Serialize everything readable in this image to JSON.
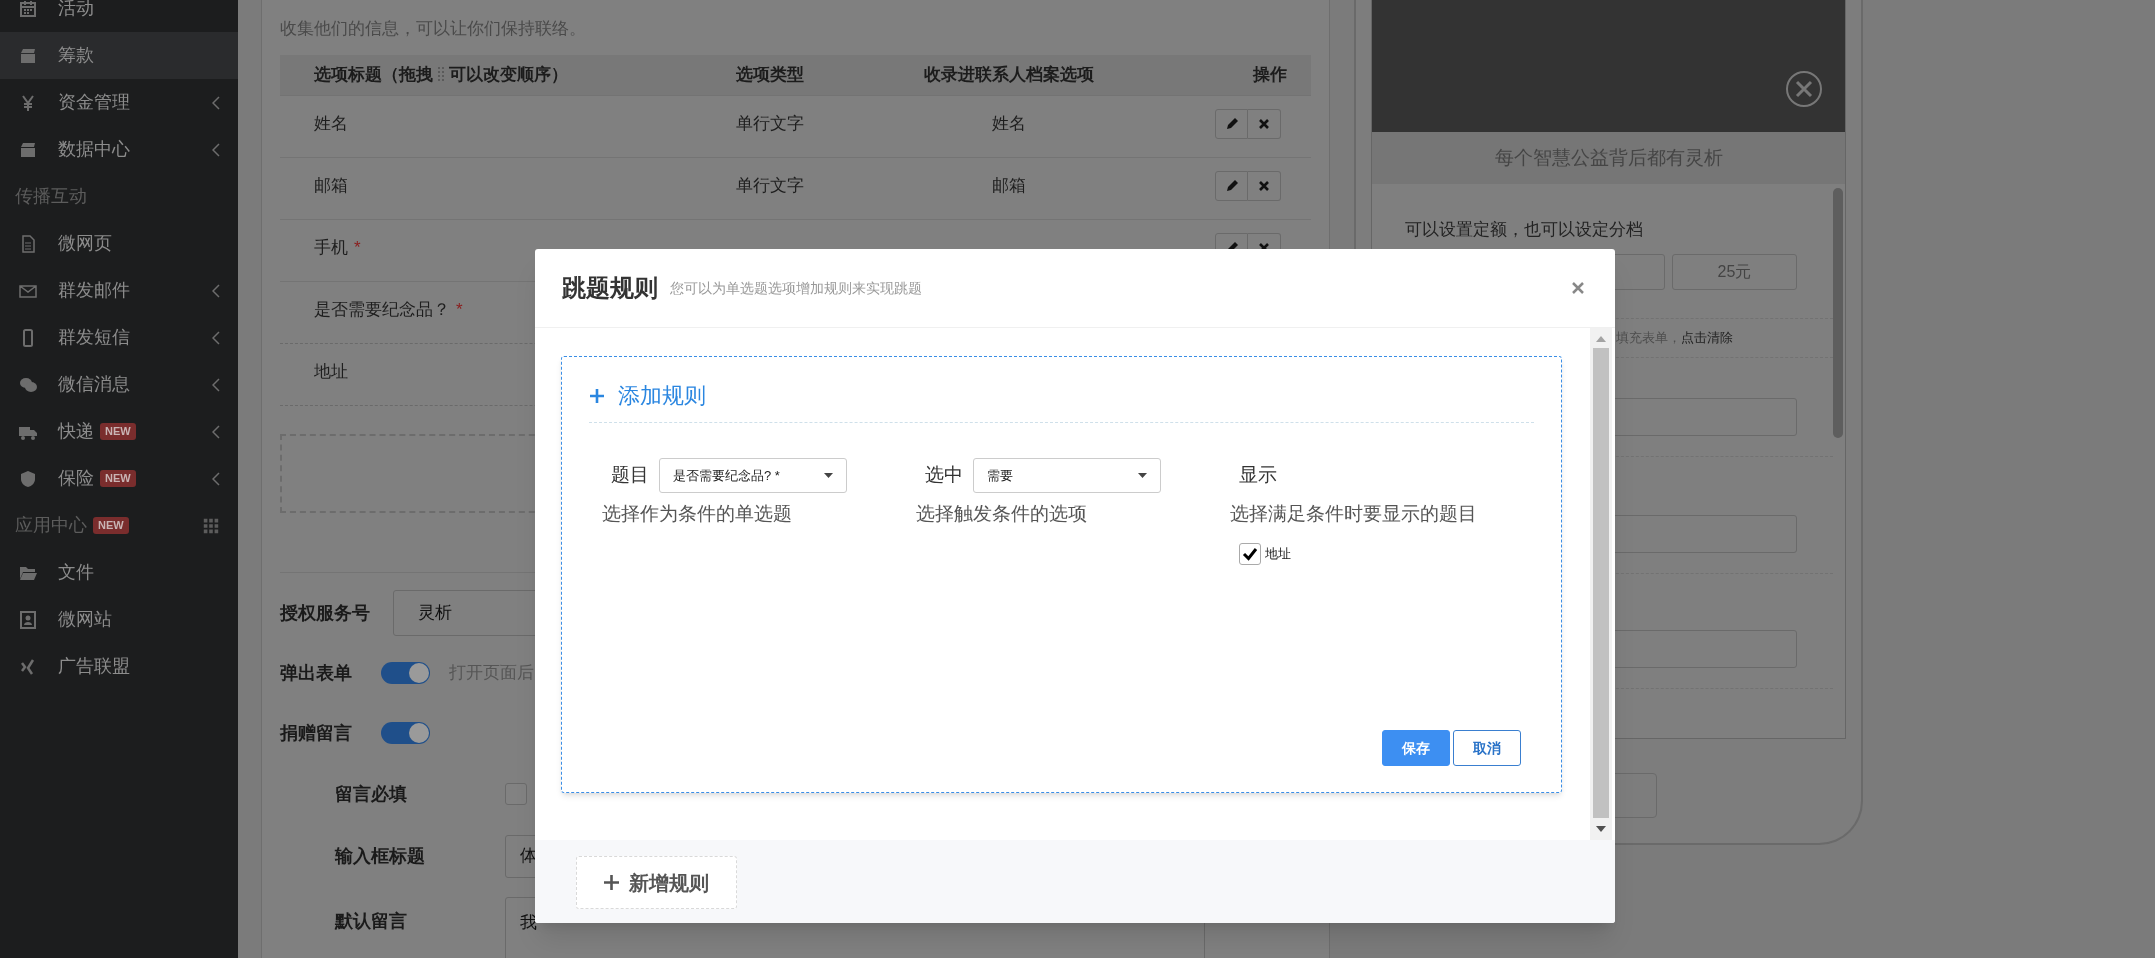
{
  "sidebar": {
    "items": [
      {
        "kind": "item",
        "label": "活动",
        "selected": false,
        "submenu": false
      },
      {
        "kind": "item",
        "label": "筹款",
        "selected": true,
        "submenu": false
      },
      {
        "kind": "item",
        "label": "资金管理",
        "selected": false,
        "submenu": true
      },
      {
        "kind": "item",
        "label": "数据中心",
        "selected": false,
        "submenu": true
      },
      {
        "kind": "group",
        "label": "传播互动"
      },
      {
        "kind": "item",
        "label": "微网页",
        "selected": false,
        "submenu": false
      },
      {
        "kind": "item",
        "label": "群发邮件",
        "selected": false,
        "submenu": true
      },
      {
        "kind": "item",
        "label": "群发短信",
        "selected": false,
        "submenu": true
      },
      {
        "kind": "item",
        "label": "微信消息",
        "selected": false,
        "submenu": true
      },
      {
        "kind": "item",
        "label": "快递",
        "badge": "NEW",
        "selected": false,
        "submenu": true
      },
      {
        "kind": "item",
        "label": "保险",
        "badge": "NEW",
        "selected": false,
        "submenu": true
      },
      {
        "kind": "group",
        "label": "应用中心",
        "badge": "NEW"
      },
      {
        "kind": "item",
        "label": "文件",
        "selected": false,
        "submenu": false
      },
      {
        "kind": "item",
        "label": "微网站",
        "selected": false,
        "submenu": false
      },
      {
        "kind": "item",
        "label": "广告联盟",
        "selected": false,
        "submenu": false
      }
    ]
  },
  "form_fields": {
    "intro": "收集他们的信息，可以让你们保持联络。",
    "columns": [
      {
        "label": "选项标题（拖拽",
        "label_after": "可以改变顺序）"
      },
      {
        "label": "选项类型"
      },
      {
        "label": "收录进联系人档案选项"
      },
      {
        "label": "操作"
      }
    ],
    "rows": [
      {
        "title": "姓名",
        "type": "单行文字",
        "contact": "姓名",
        "actions": true
      },
      {
        "title": "邮箱",
        "type": "单行文字",
        "contact": "邮箱",
        "actions": true
      },
      {
        "title": "手机",
        "mark": "*",
        "actions": true
      },
      {
        "title": "是否需要纪念品？",
        "mark": "*"
      },
      {
        "title": "地址"
      }
    ]
  },
  "settings": [
    {
      "kind": "select",
      "label": "授权服务号",
      "value": "灵析"
    },
    {
      "kind": "toggle",
      "label": "弹出表单",
      "on": true,
      "hint": "打开页面后"
    },
    {
      "kind": "toggle",
      "label": "捐赠留言",
      "on": true,
      "children": [
        {
          "kind": "checkbox",
          "label": "留言必填",
          "checked": false
        },
        {
          "kind": "input",
          "label": "输入框标题",
          "value": "体"
        },
        {
          "kind": "textarea",
          "label": "默认留言",
          "value": "我"
        }
      ]
    }
  ],
  "preview": {
    "banner": "每个智慧公益背后都有灵析",
    "amount_prompt": "可以设置定额，也可以设定分档",
    "amounts": [
      "25元"
    ],
    "hint": "填充表单，",
    "hint_link": "点击清除"
  },
  "modal": {
    "title": "跳题规则",
    "subtitle": "您可以为单选题选项增加规则来实现跳题",
    "rule": {
      "add_label": "添加规则",
      "conditions": [
        {
          "label": "题目",
          "value": "是否需要纪念品? *",
          "hint": "选择作为条件的单选题"
        },
        {
          "label": "选中",
          "value": "需要",
          "hint": "选择触发条件的选项"
        }
      ],
      "show": {
        "label": "显示",
        "hint": "选择满足条件时要显示的题目",
        "options": [
          {
            "label": "地址",
            "checked": true
          }
        ]
      },
      "buttons": [
        {
          "kind": "primary",
          "label": "保存"
        },
        {
          "kind": "secondary",
          "label": "取消"
        }
      ]
    },
    "footer_button": "新增规则"
  }
}
